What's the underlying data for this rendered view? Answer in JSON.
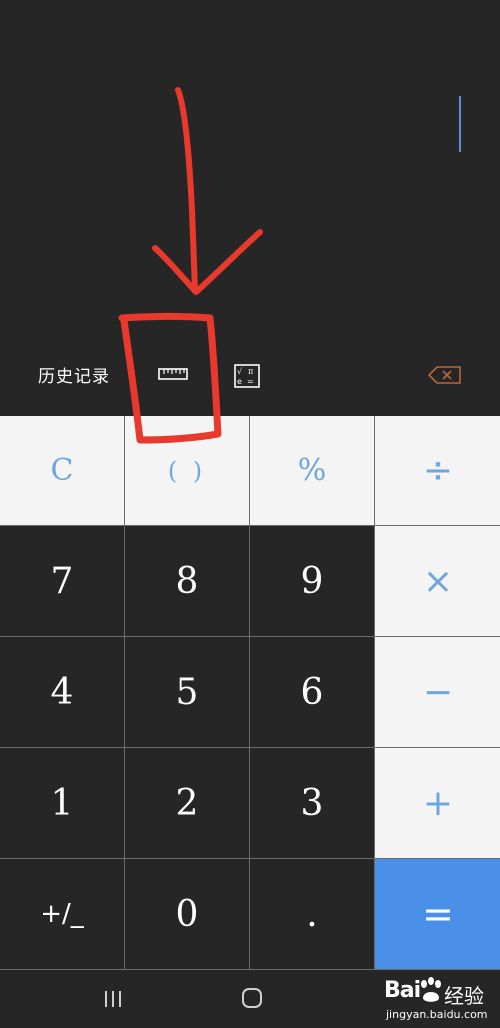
{
  "toolbar": {
    "history_label": "历史记录",
    "ruler_icon": "ruler-icon",
    "scientific_icon": "scientific-mode-icon",
    "backspace_icon": "backspace-icon"
  },
  "keys": {
    "clear": "C",
    "parentheses": "( )",
    "percent": "%",
    "divide": "÷",
    "seven": "7",
    "eight": "8",
    "nine": "9",
    "multiply": "×",
    "four": "4",
    "five": "5",
    "six": "6",
    "minus": "−",
    "one": "1",
    "two": "2",
    "three": "3",
    "plus": "+",
    "plus_minus": "+/_",
    "zero": "0",
    "decimal": ".",
    "equals": "="
  },
  "watermark": {
    "brand": "Bai",
    "jingyan": "经验",
    "url": "jingyan.baidu.com"
  },
  "colors": {
    "background": "#262626",
    "light_key": "#f4f4f4",
    "accent": "#6fa6dc",
    "equals": "#4a90e8",
    "annotation": "#e8392c"
  }
}
